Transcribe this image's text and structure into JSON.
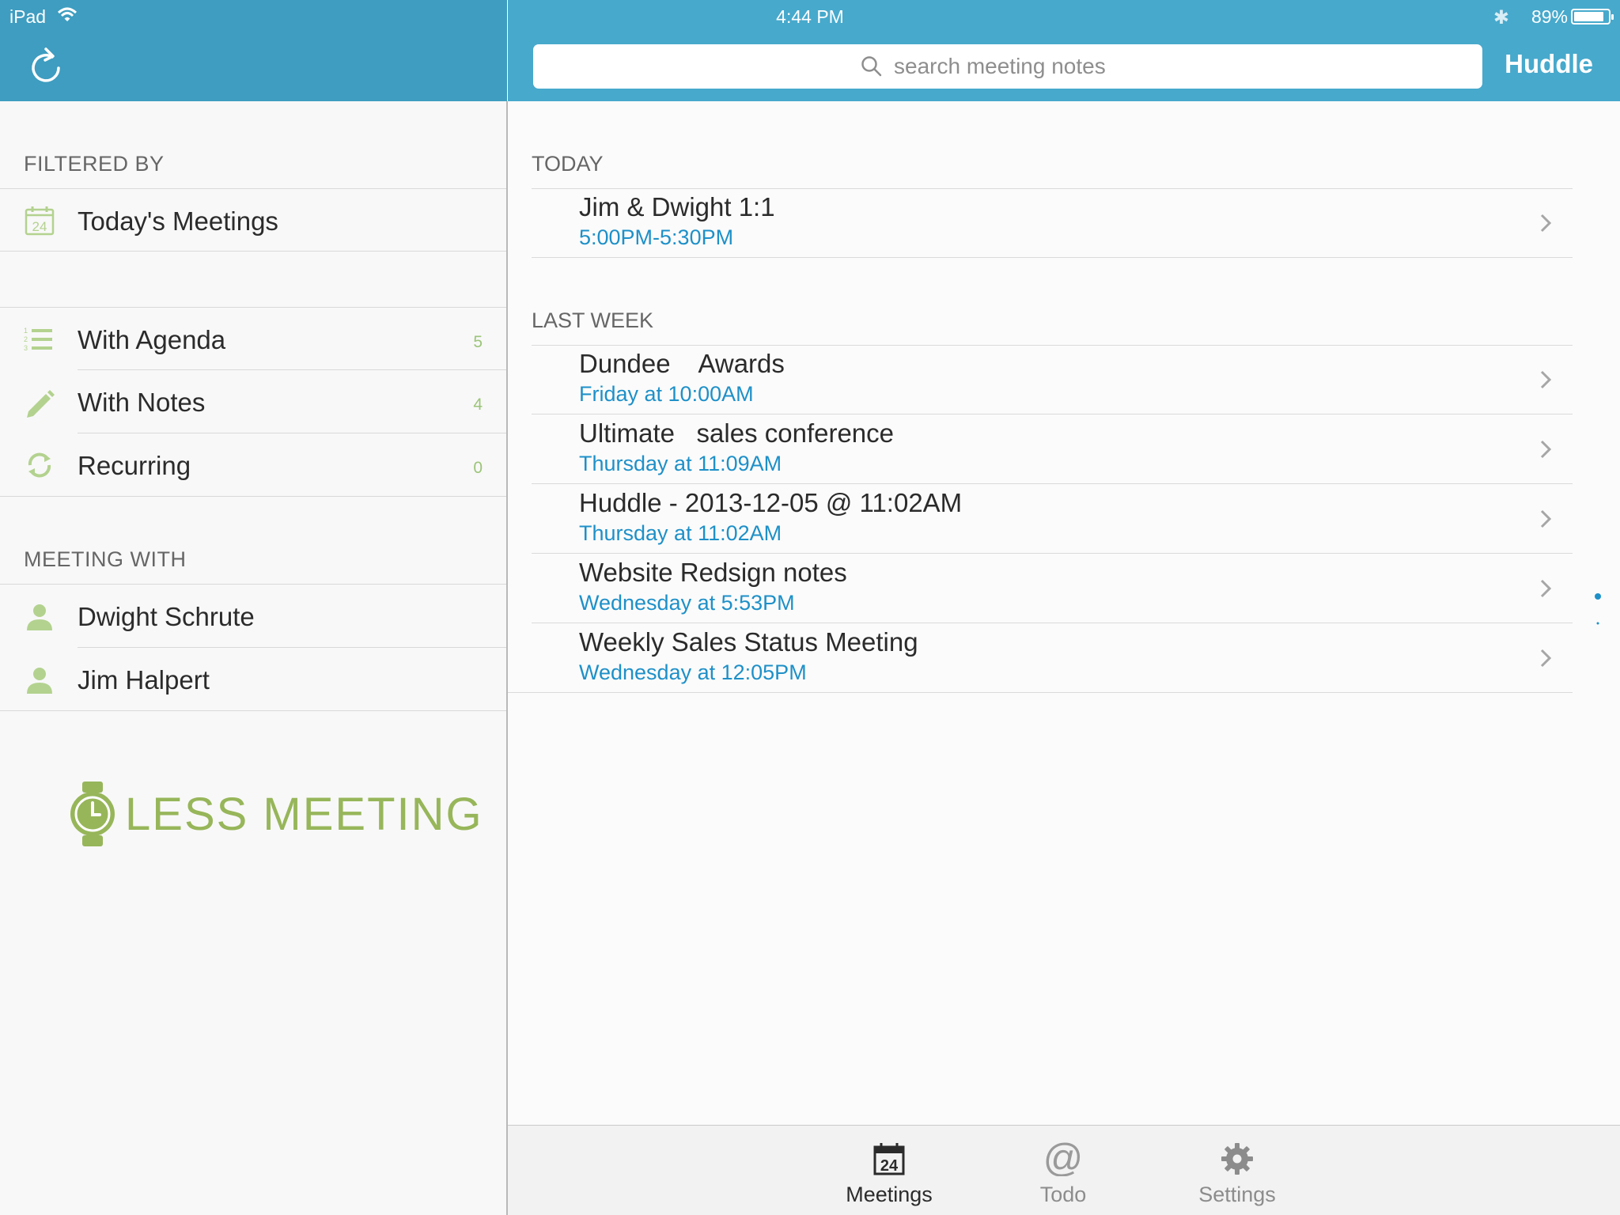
{
  "status_bar": {
    "carrier": "iPad",
    "time": "4:44 PM",
    "battery": "89%",
    "battery_level": 0.89
  },
  "header": {
    "search_placeholder": "search meeting notes",
    "right_button": "Huddle"
  },
  "sidebar": {
    "filtered_by_title": "FILTERED BY",
    "calendar_day": "24",
    "todays_meetings": "Today's Meetings",
    "filters": [
      {
        "label": "With Agenda",
        "count": "5",
        "icon": "list-icon"
      },
      {
        "label": "With Notes",
        "count": "4",
        "icon": "pencil-icon"
      },
      {
        "label": "Recurring",
        "count": "0",
        "icon": "recurring-icon"
      }
    ],
    "meeting_with_title": "MEETING WITH",
    "people": [
      {
        "name": "Dwight Schrute",
        "icon": "person-icon"
      },
      {
        "name": "Jim Halpert",
        "icon": "person-icon"
      }
    ],
    "brand": "LESS MEETING"
  },
  "main": {
    "sections": [
      {
        "title": "TODAY",
        "meetings": [
          {
            "title": "Jim & Dwight 1:1",
            "time": "5:00PM-5:30PM"
          }
        ]
      },
      {
        "title": "LAST WEEK",
        "meetings": [
          {
            "title": "Dundee    Awards",
            "time": "Friday at 10:00AM"
          },
          {
            "title": "Ultimate   sales conference",
            "time": "Thursday at 11:09AM"
          },
          {
            "title": "Huddle - 2013-12-05 @ 11:02AM",
            "time": "Thursday at 11:02AM"
          },
          {
            "title": "Website Redsign notes",
            "time": "Wednesday at 5:53PM"
          },
          {
            "title": "Weekly Sales Status Meeting",
            "time": "Wednesday at 12:05PM"
          }
        ]
      }
    ]
  },
  "tabbar": {
    "tabs": [
      {
        "label": "Meetings",
        "icon": "calendar-icon",
        "active": true
      },
      {
        "label": "Todo",
        "icon": "at-icon",
        "active": false
      },
      {
        "label": "Settings",
        "icon": "gear-icon",
        "active": false
      }
    ],
    "calendar_day": "24"
  },
  "colors": {
    "header_left": "#3e9dc0",
    "header_right": "#47a9cc",
    "accent_blue": "#1e90c8",
    "green": "#9cc47a"
  }
}
